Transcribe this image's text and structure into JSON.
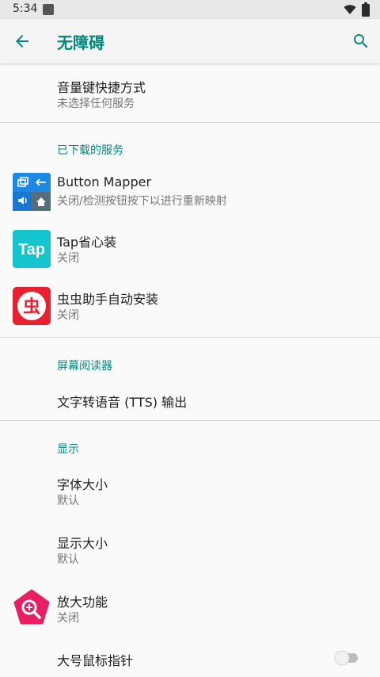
{
  "status_bar": {
    "time": "5:34",
    "icons": [
      "notification-icon",
      "wifi-icon",
      "battery-icon"
    ]
  },
  "app_bar": {
    "title": "无障碍",
    "back_icon": "arrow-back-icon",
    "search_icon": "search-icon"
  },
  "colors": {
    "accent": "#00897b",
    "background": "#fafafa",
    "divider": "#d6d6d6"
  },
  "shortcut": {
    "title": "音量键快捷方式",
    "subtitle": "未选择任何服务"
  },
  "downloaded": {
    "header": "已下载的服务",
    "items": [
      {
        "title": "Button Mapper",
        "subtitle": "关闭/检测按钮按下以进行重新映射",
        "icon": "button-mapper-icon"
      },
      {
        "title": "Tap省心装",
        "subtitle": "关闭",
        "icon": "taptap-icon",
        "icon_text": "Tap"
      },
      {
        "title": "虫虫助手自动安装",
        "subtitle": "关闭",
        "icon": "chongchong-icon",
        "icon_text": "虫"
      }
    ]
  },
  "screen_reader": {
    "header": "屏幕阅读器",
    "tts_label": "文字转语音 (TTS) 输出"
  },
  "display": {
    "header": "显示",
    "font_size": {
      "title": "字体大小",
      "subtitle": "默认"
    },
    "display_size": {
      "title": "显示大小",
      "subtitle": "默认"
    },
    "magnification": {
      "title": "放大功能",
      "subtitle": "关闭",
      "icon": "magnify-icon"
    },
    "large_pointer": {
      "title": "大号鼠标指针",
      "toggle_on": false
    }
  }
}
